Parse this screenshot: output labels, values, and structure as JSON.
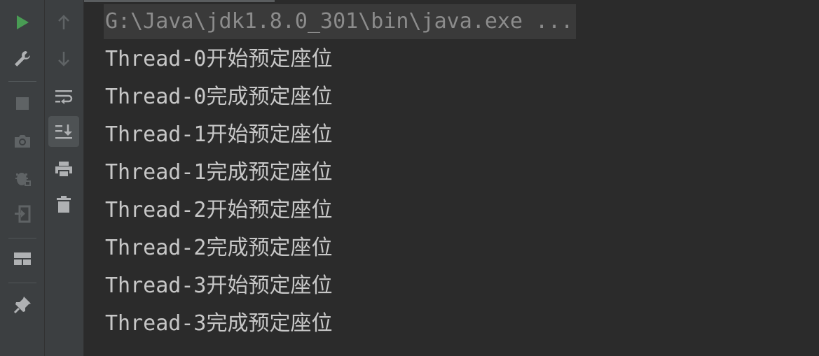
{
  "console": {
    "command_line": "G:\\Java\\jdk1.8.0_301\\bin\\java.exe ...",
    "output_lines": [
      "Thread-0开始预定座位",
      "Thread-0完成预定座位",
      "Thread-1开始预定座位",
      "Thread-1完成预定座位",
      "Thread-2开始预定座位",
      "Thread-2完成预定座位",
      "Thread-3开始预定座位",
      "Thread-3完成预定座位"
    ]
  },
  "toolbar_left": {
    "icons": [
      "run-icon",
      "wrench-icon",
      "stop-icon",
      "camera-icon",
      "debug-bug-icon",
      "exit-icon",
      "layout-icon",
      "pin-icon"
    ]
  },
  "toolbar_right": {
    "icons": [
      "arrow-up-icon",
      "arrow-down-icon",
      "soft-wrap-icon",
      "scroll-to-end-icon",
      "print-icon",
      "trash-icon"
    ]
  },
  "colors": {
    "run_green": "#499c54",
    "icon_gray": "#afb1b3",
    "icon_disabled": "#5f6365",
    "console_text": "#c7c7c7",
    "command_text": "#8c8c8c"
  }
}
